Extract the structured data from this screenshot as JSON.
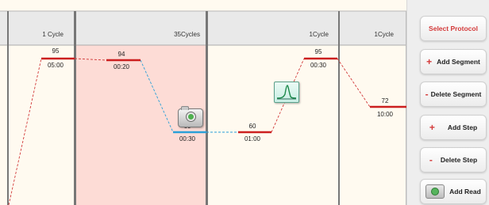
{
  "stages": [
    {
      "cycles": "1 Cycle"
    },
    {
      "cycles": "35Cycles"
    },
    {
      "cycles": "1Cycle"
    },
    {
      "cycles": "1Cycle"
    }
  ],
  "steps": [
    {
      "temp": "95",
      "time": "05:00",
      "color": "#cc1f1f"
    },
    {
      "temp": "94",
      "time": "00:20",
      "color": "#cc1f1f"
    },
    {
      "temp": "60",
      "time": "00:30",
      "color": "#2aa0d8"
    },
    {
      "temp": "60",
      "time": "01:00",
      "color": "#cc1f1f"
    },
    {
      "temp": "95",
      "time": "00:30",
      "color": "#cc1f1f"
    },
    {
      "temp": "72",
      "time": "10:00",
      "color": "#cc1f1f"
    }
  ],
  "highlight_color": "#fddcd6",
  "sidebar": {
    "select_protocol": "Select Protocol",
    "add_segment": "Add Segment",
    "delete_segment": "Delete Segment",
    "add_step": "Add Step",
    "delete_step": "Delete Step",
    "add_read": "Add Read",
    "plus_symbol": "+",
    "minus_symbol": "-"
  },
  "icons": {
    "camera": "camera-icon",
    "melt_curve": "melt-curve-icon"
  }
}
